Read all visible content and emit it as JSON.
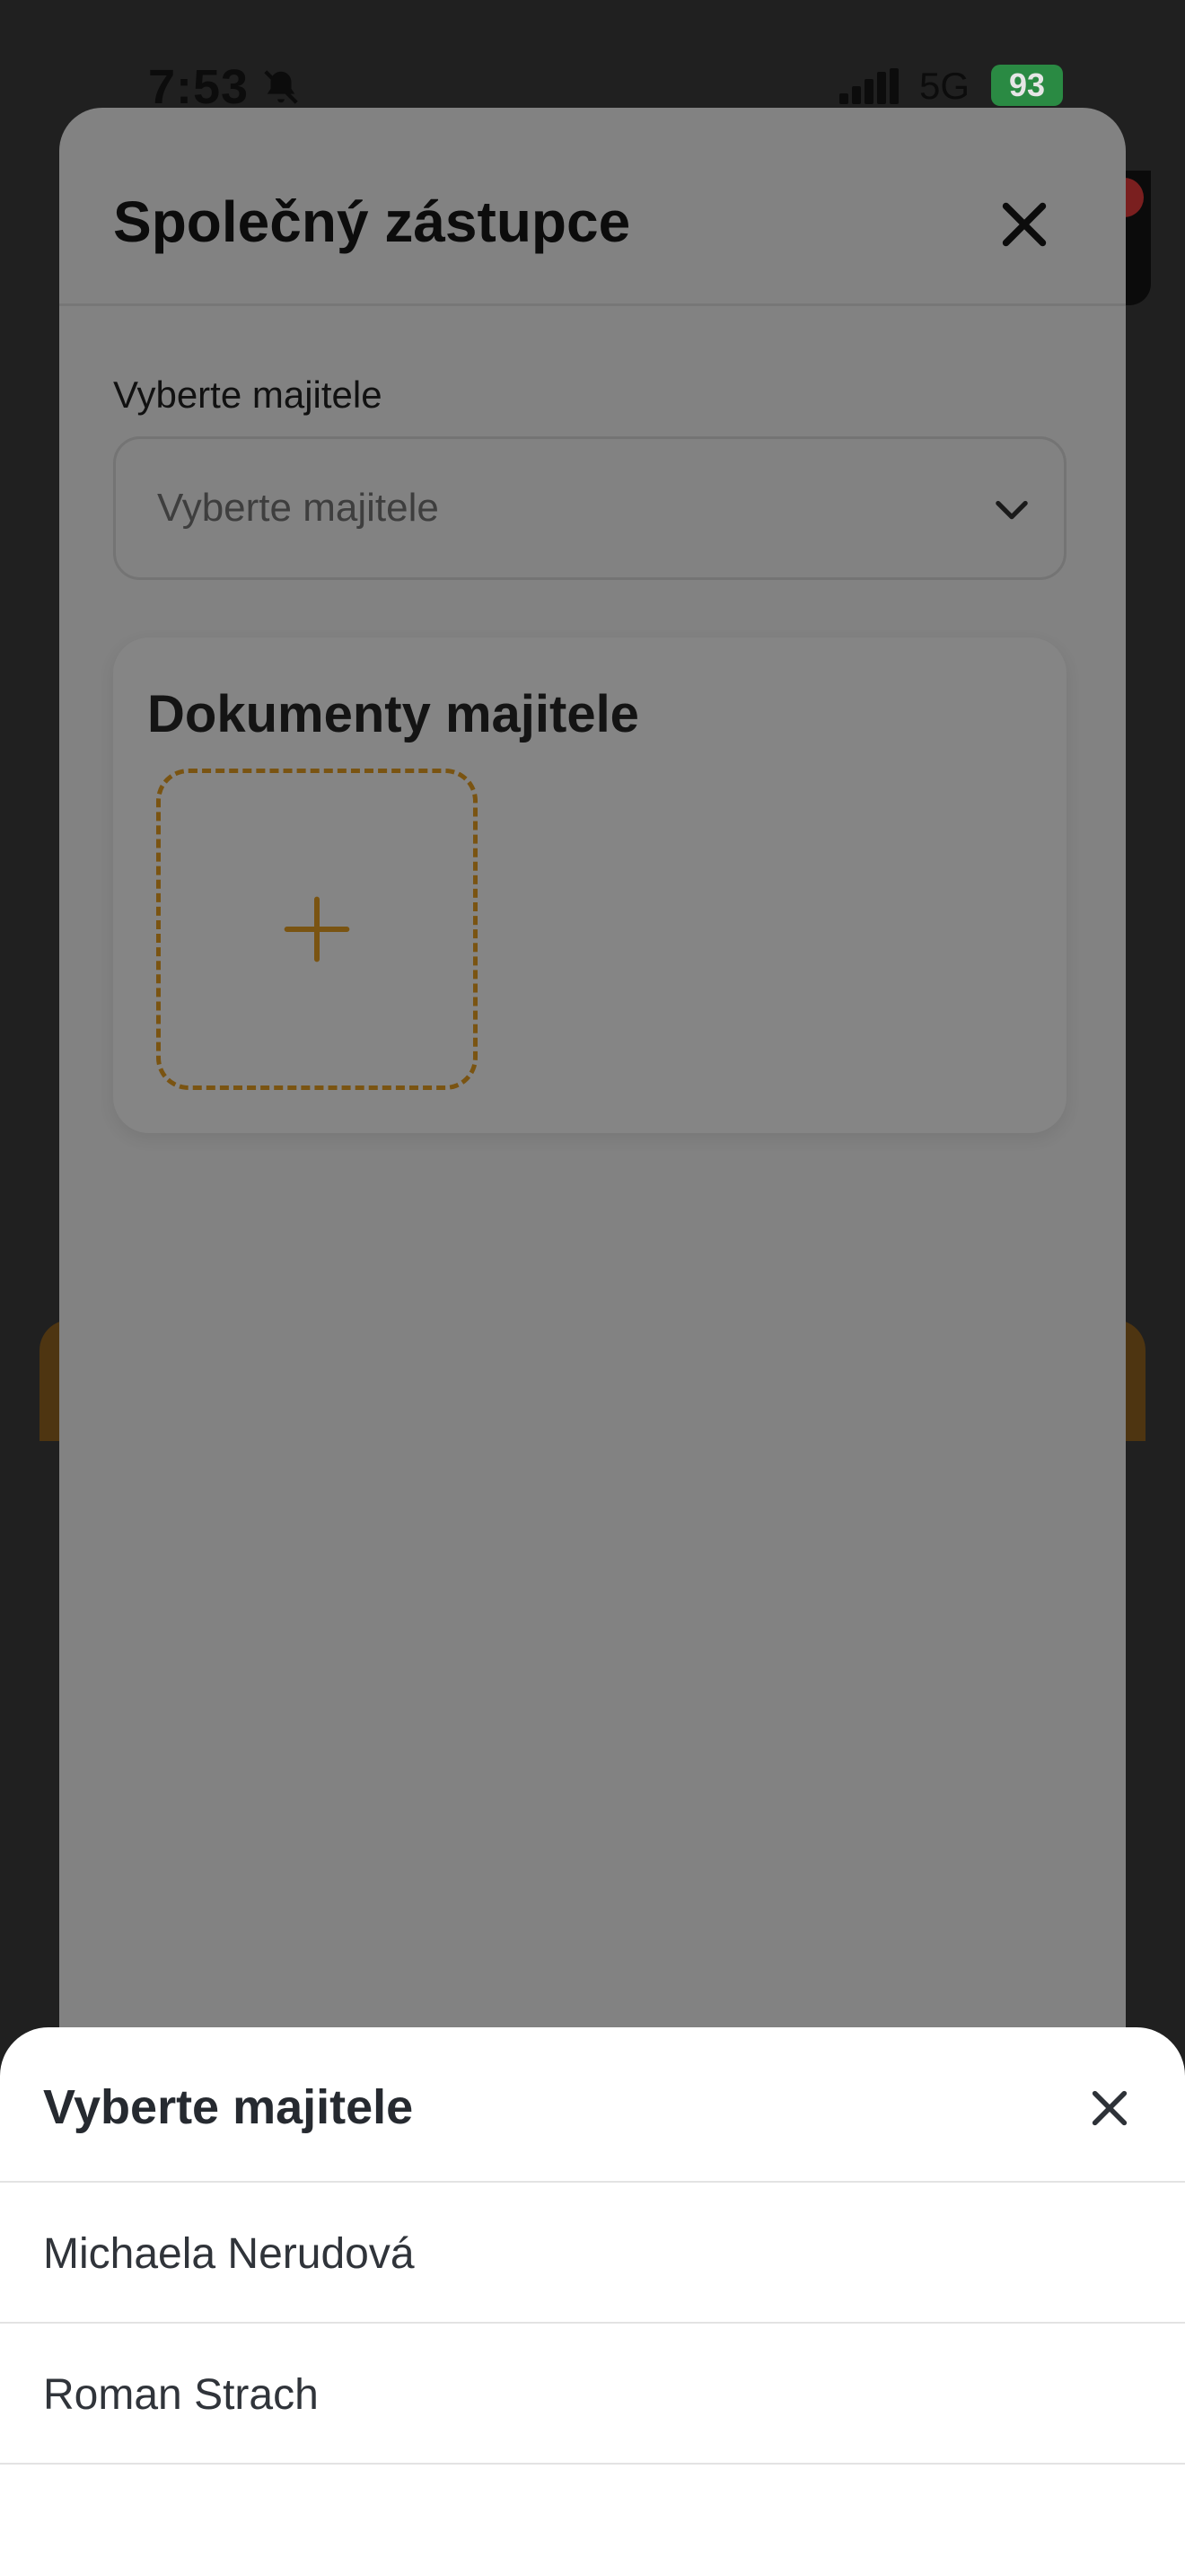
{
  "status_bar": {
    "time": "7:53",
    "network": "5G",
    "battery": "93"
  },
  "modal": {
    "title": "Společný zástupce",
    "owner_field": {
      "label": "Vyberte majitele",
      "placeholder": "Vyberte majitele"
    },
    "documents": {
      "title": "Dokumenty majitele"
    }
  },
  "picker_sheet": {
    "title": "Vyberte majitele",
    "options": [
      {
        "label": "Michaela Nerudová"
      },
      {
        "label": "Roman Strach"
      }
    ]
  },
  "colors": {
    "accent": "#e8a020",
    "battery": "#34c759",
    "overlay": "rgba(0,0,0,0.5)"
  }
}
